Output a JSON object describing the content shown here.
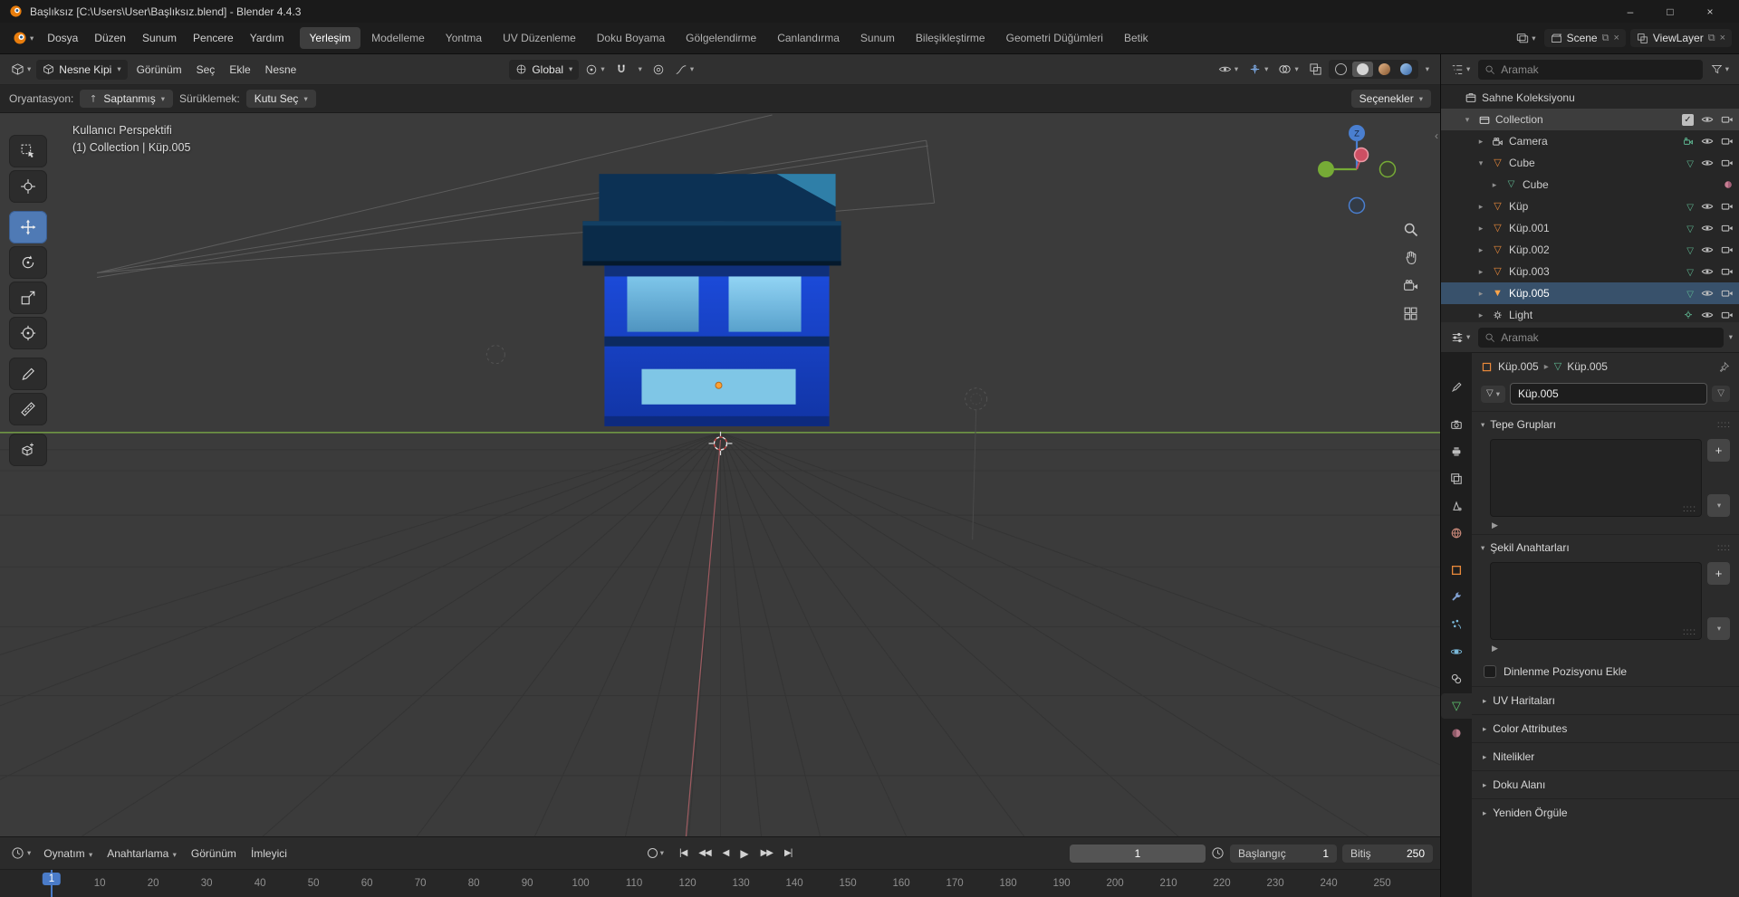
{
  "window": {
    "title": "Başlıksız [C:\\Users\\User\\Başlıksız.blend] - Blender 4.4.3",
    "controls": {
      "minimize": "–",
      "maximize": "□",
      "close": "×"
    }
  },
  "menubar": {
    "menus": [
      "Dosya",
      "Düzen",
      "Sunum",
      "Pencere",
      "Yardım"
    ],
    "workspaces": [
      "Yerleşim",
      "Modelleme",
      "Yontma",
      "UV Düzenleme",
      "Doku Boyama",
      "Gölgelendirme",
      "Canlandırma",
      "Sunum",
      "Bileşikleştirme",
      "Geometri Düğümleri",
      "Betik"
    ],
    "active_workspace": "Yerleşim",
    "scene_name": "Scene",
    "viewlayer_name": "ViewLayer"
  },
  "viewport_header": {
    "mode_label": "Nesne Kipi",
    "menus": [
      "Görünüm",
      "Seç",
      "Ekle",
      "Nesne"
    ],
    "orientation_value": "Global"
  },
  "tool_settings": {
    "orientation_label": "Oryantasyon:",
    "orientation_value": "Saptanmış",
    "drag_label": "Sürüklemek:",
    "drag_value": "Kutu Seç",
    "options_label": "Seçenekler"
  },
  "toolbar": {
    "active": "move",
    "groups": [
      [
        "select-box",
        "cursor"
      ],
      [
        "move",
        "rotate",
        "scale",
        "transform"
      ],
      [
        "annotate",
        "measure"
      ],
      [
        "add-cube"
      ]
    ]
  },
  "viewport": {
    "view_label": "Kullanıcı Perspektifi",
    "context_label": "(1) Collection | Küp.005",
    "gizmo_z_label": "Z",
    "colors": {
      "accent": "#4772b3",
      "axis_x": "#cd4f63",
      "axis_y": "#76ab36",
      "axis_z": "#4a7fd0",
      "object_orange": "#e8883a",
      "mesh_green": "#5fb892"
    }
  },
  "outliner": {
    "search_placeholder": "Aramak",
    "rows": [
      {
        "label": "Sahne Koleksiyonu",
        "icon": "scene-collection",
        "arrow": "",
        "indent": 0,
        "right": []
      },
      {
        "label": "Collection",
        "icon": "collection",
        "arrow": "open",
        "indent": 1,
        "right": [
          "checkbox",
          "eye",
          "camera"
        ],
        "highlight": true
      },
      {
        "label": "Camera",
        "icon": "camera-object",
        "arrow": "closed",
        "indent": 2,
        "badge": "camera-data",
        "right": [
          "eye",
          "camera"
        ]
      },
      {
        "label": "Cube",
        "icon": "mesh-object",
        "arrow": "open",
        "indent": 2,
        "badge": "mesh-data",
        "right": [
          "eye",
          "camera"
        ]
      },
      {
        "label": "Cube",
        "icon": "mesh-data",
        "arrow": "closed",
        "indent": 3,
        "badge": "material",
        "right": []
      },
      {
        "label": "Küp",
        "icon": "mesh-object",
        "arrow": "closed",
        "indent": 2,
        "badge": "mesh-data",
        "right": [
          "eye",
          "camera"
        ]
      },
      {
        "label": "Küp.001",
        "icon": "mesh-object",
        "arrow": "closed",
        "indent": 2,
        "badge": "mesh-data",
        "right": [
          "eye",
          "camera"
        ]
      },
      {
        "label": "Küp.002",
        "icon": "mesh-object",
        "arrow": "closed",
        "indent": 2,
        "badge": "mesh-data",
        "right": [
          "eye",
          "camera"
        ]
      },
      {
        "label": "Küp.003",
        "icon": "mesh-object",
        "arrow": "closed",
        "indent": 2,
        "badge": "mesh-data",
        "right": [
          "eye",
          "camera"
        ]
      },
      {
        "label": "Küp.005",
        "icon": "mesh-object-active",
        "arrow": "closed",
        "indent": 2,
        "badge": "mesh-data",
        "right": [
          "eye",
          "camera"
        ],
        "active": true
      },
      {
        "label": "Light",
        "icon": "light-object",
        "arrow": "closed",
        "indent": 2,
        "badge": "light-data",
        "right": [
          "eye",
          "camera"
        ]
      }
    ]
  },
  "properties": {
    "search_placeholder": "Aramak",
    "breadcrumb": {
      "object": "Küp.005",
      "data": "Küp.005"
    },
    "name_value": "Küp.005",
    "vertex_groups_title": "Tepe Grupları",
    "shape_keys_title": "Şekil Anahtarları",
    "rest_position_label": "Dinlenme Pozisyonu Ekle",
    "collapsed_panels": [
      "UV Haritaları",
      "Color Attributes",
      "Nitelikler",
      "Doku Alanı",
      "Yeniden Örgüle"
    ],
    "tab_groups": [
      [
        "tool"
      ],
      [
        "render",
        "output",
        "view-layer",
        "scene",
        "world"
      ],
      [
        "object",
        "modifiers",
        "particles",
        "physics",
        "constraints",
        "data",
        "material"
      ]
    ],
    "active_tab": "data"
  },
  "timeline": {
    "menus": [
      {
        "label": "Oynatım",
        "chevron": true
      },
      {
        "label": "Anahtarlama",
        "chevron": true
      },
      {
        "label": "Görünüm",
        "chevron": false
      },
      {
        "label": "İmleyici",
        "chevron": false
      }
    ],
    "transport": [
      {
        "name": "jump-start",
        "glyph": "|◀"
      },
      {
        "name": "prev-keyframe",
        "glyph": "◀◀"
      },
      {
        "name": "play-reverse",
        "glyph": "◀"
      },
      {
        "name": "play",
        "glyph": "▶"
      },
      {
        "name": "next-keyframe",
        "glyph": "▶▶"
      },
      {
        "name": "jump-end",
        "glyph": "▶|"
      }
    ],
    "current_frame": "1",
    "start_label": "Başlangıç",
    "start_value": "1",
    "end_label": "Bitiş",
    "end_value": "250",
    "playhead_frame": 1,
    "ruler_ticks": [
      10,
      20,
      30,
      40,
      50,
      60,
      70,
      80,
      90,
      100,
      110,
      120,
      130,
      140,
      150,
      160,
      170,
      180,
      190,
      200,
      210,
      220,
      230,
      240,
      250
    ]
  }
}
